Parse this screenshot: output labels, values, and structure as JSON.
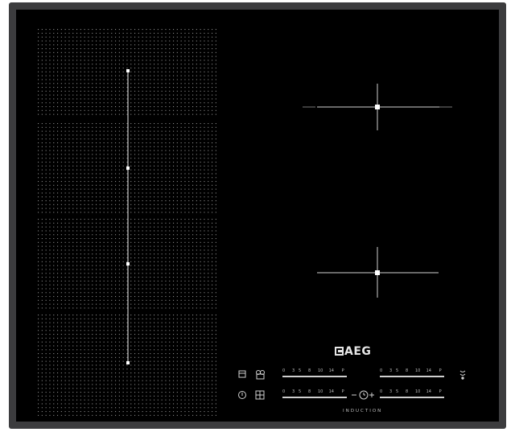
{
  "brand": {
    "logo_text": "AEG",
    "product_label": "INDUCTION"
  },
  "controls": {
    "slider_scale": [
      "0",
      "3",
      "5",
      "8",
      "10",
      "14",
      "P"
    ],
    "sliders": [
      {
        "id": "slider-top-left"
      },
      {
        "id": "slider-top-right"
      },
      {
        "id": "slider-bottom-left"
      },
      {
        "id": "slider-bottom-right"
      }
    ]
  },
  "cooking_zones": {
    "flex_zone": {
      "sections": 4
    },
    "fixed_zones": 2
  },
  "icons": [
    "timer-icon",
    "chef-hat-icon",
    "power-icon",
    "lock-icon",
    "minus-icon",
    "clock-icon",
    "plus-icon",
    "bridge-icon"
  ],
  "colors": {
    "glass": "#000000",
    "frame": "#3c3c3e",
    "markings": "#bdbdbd"
  }
}
